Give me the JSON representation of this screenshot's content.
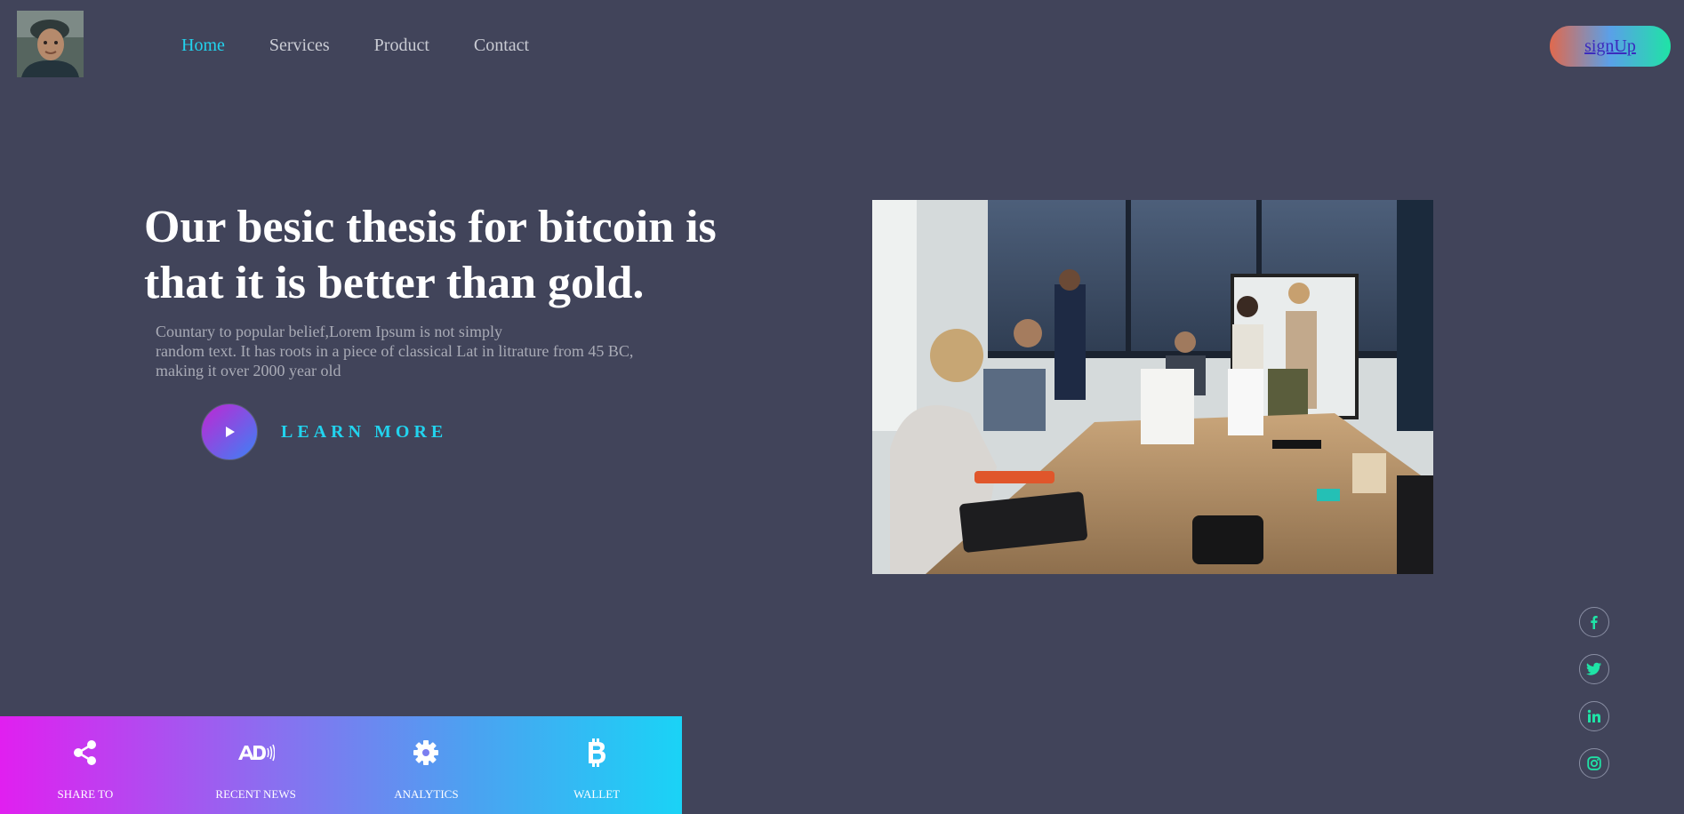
{
  "header": {
    "nav": [
      {
        "label": "Home",
        "active": true
      },
      {
        "label": "Services",
        "active": false
      },
      {
        "label": "Product",
        "active": false
      },
      {
        "label": "Contact",
        "active": false
      }
    ],
    "signup_label": "signUp"
  },
  "hero": {
    "title": "Our besic thesis for bitcoin is that it is better than gold.",
    "description_lines": [
      "Countary to popular belief,Lorem Ipsum is not simply",
      "random text. It has roots in a piece of classical Lat in litrature from 45 BC,",
      "making it over 2000 year old"
    ],
    "cta_label": "LEARN MORE"
  },
  "social": [
    "facebook-icon",
    "twitter-icon",
    "linkedin-icon",
    "instagram-icon"
  ],
  "bottom_bar": {
    "items": [
      {
        "label": "SHARE TO",
        "icon": "share-icon"
      },
      {
        "label": "RECENT NEWS",
        "icon": "ad-icon"
      },
      {
        "label": "ANALYTICS",
        "icon": "gear-icon"
      },
      {
        "label": "WALLET",
        "icon": "bitcoin-icon"
      }
    ]
  },
  "colors": {
    "background": "#41445a",
    "accent": "#22d3ee",
    "social_icon": "#1fe3a6"
  }
}
